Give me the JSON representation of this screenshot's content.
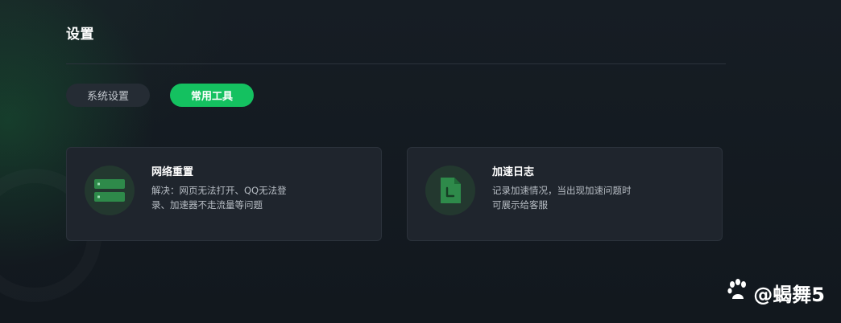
{
  "page": {
    "title": "设置"
  },
  "tabs": [
    {
      "label": "系统设置",
      "active": false
    },
    {
      "label": "常用工具",
      "active": true
    }
  ],
  "cards": [
    {
      "title": "网络重置",
      "desc_line1": "解决：网页无法打开、QQ无法登",
      "desc_line2": "录、加速器不走流量等问题",
      "icon": "server-icon"
    },
    {
      "title": "加速日志",
      "desc_line1": "记录加速情况，当出现加速问题时",
      "desc_line2": "可展示给客服",
      "icon": "log-file-icon"
    }
  ],
  "watermark": {
    "text": "@蝎舞5",
    "icon": "paw-logo-icon"
  },
  "colors": {
    "accent": "#14c160",
    "background": "#141a21",
    "card": "#1f252d",
    "icon_green": "#2e8a4a"
  }
}
